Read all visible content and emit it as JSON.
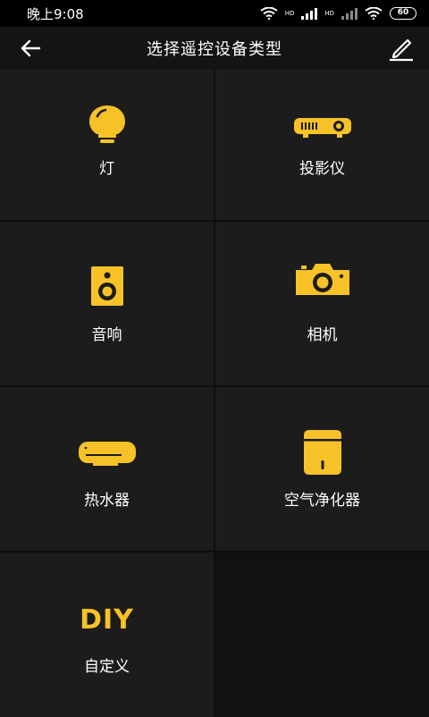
{
  "status_bar": {
    "time": "晚上9:08",
    "net_label_1": "HD",
    "net_label_2": "HD",
    "battery": "60"
  },
  "header": {
    "title": "选择遥控设备类型"
  },
  "colors": {
    "accent": "#f6c228",
    "background": "#141414",
    "cell": "#1c1c1c"
  },
  "devices": [
    {
      "label": "灯",
      "icon": "bulb-icon"
    },
    {
      "label": "投影仪",
      "icon": "projector-icon"
    },
    {
      "label": "音响",
      "icon": "speaker-icon"
    },
    {
      "label": "相机",
      "icon": "camera-icon"
    },
    {
      "label": "热水器",
      "icon": "water-heater-icon"
    },
    {
      "label": "空气净化器",
      "icon": "air-purifier-icon"
    },
    {
      "label": "自定义",
      "icon": "diy-icon",
      "icon_text": "DIY"
    }
  ]
}
